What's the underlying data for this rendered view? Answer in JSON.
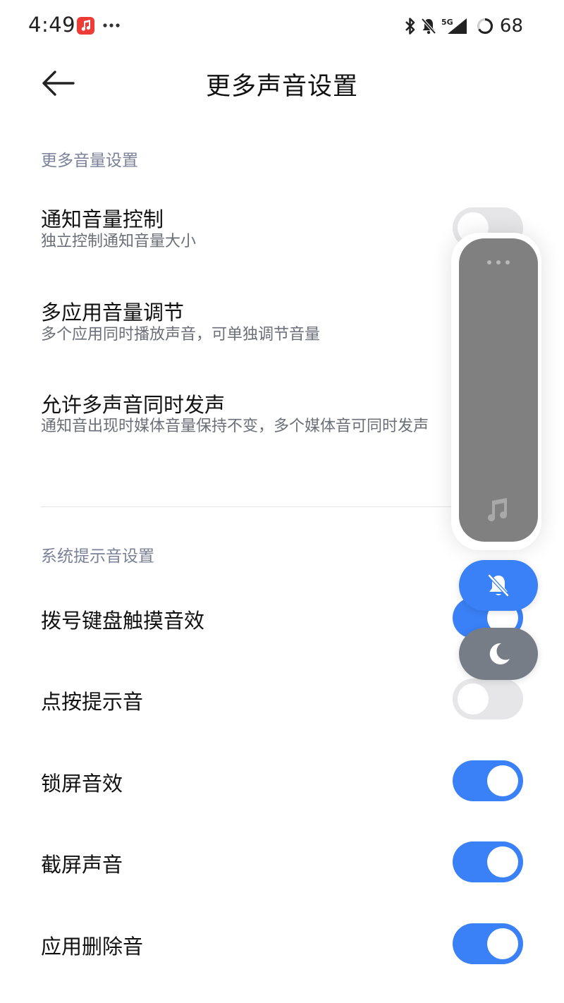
{
  "status_bar": {
    "time": "4:49",
    "app_icon": "music-app-icon",
    "overflow": "more-dots",
    "icons": [
      "bluetooth-icon",
      "bell-muted-icon",
      "5g-signal-icon"
    ],
    "battery": "68"
  },
  "header": {
    "back_icon": "arrow-left-icon",
    "title": "更多声音设置"
  },
  "sections": [
    {
      "title": "更多音量设置",
      "rows": [
        {
          "title": "通知音量控制",
          "subtitle": "独立控制通知音量大小",
          "toggle": "off"
        },
        {
          "title": "多应用音量调节",
          "subtitle": "多个应用同时播放声音，可单独调节音量",
          "toggle": "off"
        },
        {
          "title": "允许多声音同时发声",
          "subtitle": "通知音出现时媒体音量保持不变，多个媒体音可同时发声",
          "toggle": "off"
        }
      ]
    },
    {
      "title": "系统提示音设置",
      "rows": [
        {
          "title": "拨号键盘触摸音效",
          "toggle": "on"
        },
        {
          "title": "点按提示音",
          "toggle": "off"
        },
        {
          "title": "锁屏音效",
          "toggle": "on"
        },
        {
          "title": "截屏声音",
          "toggle": "on"
        },
        {
          "title": "应用删除音",
          "toggle": "on"
        }
      ]
    }
  ],
  "volume_overlay": {
    "more_icon": "more-dots-icon",
    "stream_icon": "music-note-icon",
    "ring_mode_icon": "bell-muted-icon",
    "dnd_icon": "moon-icon"
  },
  "colors": {
    "accent": "#3a80f6",
    "section_title": "#7b8199",
    "toggle_off": "#e6e6e8",
    "panel": "#808080"
  }
}
